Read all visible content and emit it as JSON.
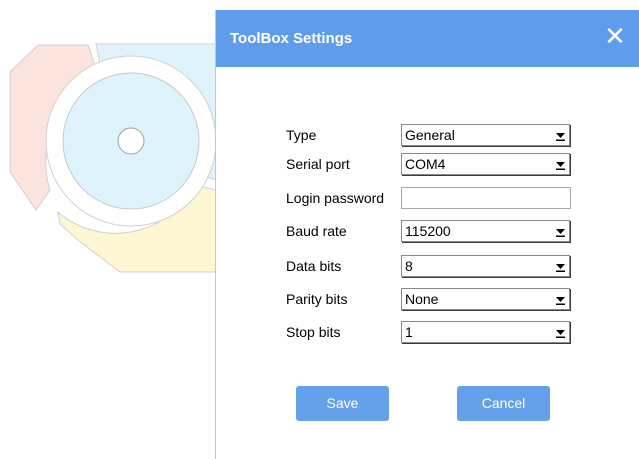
{
  "dialog": {
    "title": "ToolBox Settings",
    "close_symbol": "✕"
  },
  "form": {
    "fields": [
      {
        "label": "Type",
        "kind": "select",
        "value": "General"
      },
      {
        "label": "Serial port",
        "kind": "select",
        "value": "COM4"
      },
      {
        "label": "Login password",
        "kind": "text",
        "value": ""
      },
      {
        "label": "Baud rate",
        "kind": "select",
        "value": "115200"
      },
      {
        "label": "Data bits",
        "kind": "select",
        "value": "8"
      },
      {
        "label": "Parity bits",
        "kind": "select",
        "value": "None"
      },
      {
        "label": "Stop bits",
        "kind": "select",
        "value": "1"
      }
    ]
  },
  "buttons": {
    "save_label": "Save",
    "cancel_label": "Cancel"
  },
  "icons": {
    "close": "close-icon",
    "dropdown": "chevron-down-icon",
    "background_logo": "logo-icon"
  },
  "colors": {
    "titlebar": "#5f9cea",
    "button": "#64a1ea",
    "logo_pink": "#fde3dd",
    "logo_blue": "#dff3fd",
    "logo_yellow": "#fdf7d3"
  }
}
